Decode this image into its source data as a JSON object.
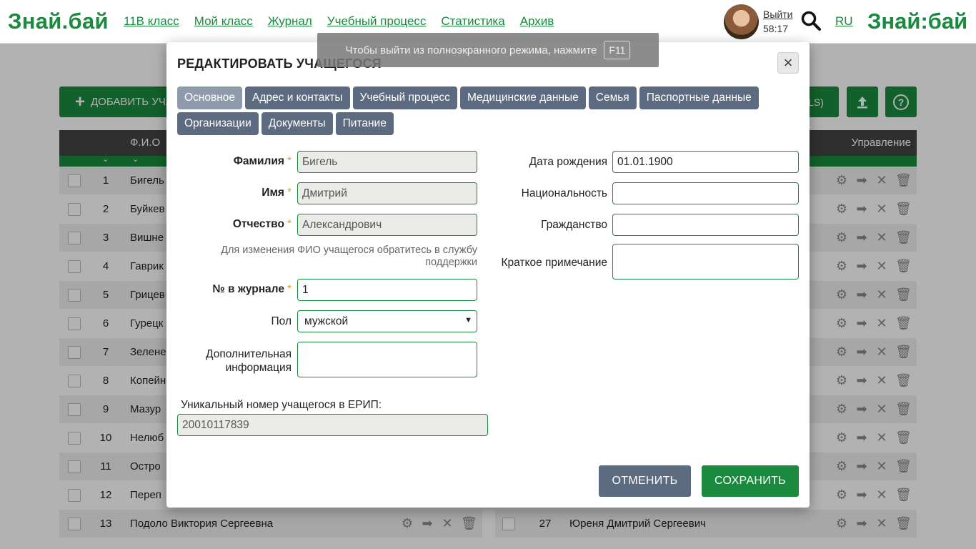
{
  "header": {
    "logo": "Знай.бай",
    "logo_right": "Знай:бай",
    "nav": [
      "11В класс",
      "Мой класс",
      "Журнал",
      "Учебный процесс",
      "Статистика",
      "Архив"
    ],
    "logout": "Выйти",
    "timer": "58:17",
    "lang": "RU"
  },
  "page": {
    "add_button": "ДОБАВИТЬ УЧА",
    "xls_button": "LS)",
    "col_fio": "Ф.И.О",
    "col_controls": "Управление",
    "rows_left": [
      {
        "num": "1",
        "name": "Бигель"
      },
      {
        "num": "2",
        "name": "Буйкев"
      },
      {
        "num": "3",
        "name": "Вишне"
      },
      {
        "num": "4",
        "name": "Гаврик"
      },
      {
        "num": "5",
        "name": "Грицев"
      },
      {
        "num": "6",
        "name": "Гурецк"
      },
      {
        "num": "7",
        "name": "Зелене"
      },
      {
        "num": "8",
        "name": "Копейн"
      },
      {
        "num": "9",
        "name": "Мазур"
      },
      {
        "num": "10",
        "name": "Нелюб"
      },
      {
        "num": "11",
        "name": "Остро"
      },
      {
        "num": "12",
        "name": "Переп"
      },
      {
        "num": "13",
        "name": "Подоло Виктория Сергеевна"
      }
    ],
    "row_right_13": {
      "num": "27",
      "name": "Юреня Дмитрий Сергеевич"
    }
  },
  "toast": {
    "text": "Чтобы выйти из полноэкранного режима, нажмите",
    "key": "F11"
  },
  "modal": {
    "title": "РЕДАКТИРОВАТЬ УЧАЩЕГОСЯ",
    "tabs": [
      "Основное",
      "Адрес и контакты",
      "Учебный процесс",
      "Медицинские данные",
      "Семья",
      "Паспортные данные",
      "Организации",
      "Документы",
      "Питание"
    ],
    "active_tab": "Основное",
    "fields": {
      "surname_label": "Фамилия",
      "surname_value": "Бигель",
      "name_label": "Имя",
      "name_value": "Дмитрий",
      "patronymic_label": "Отчество",
      "patronymic_value": "Александрович",
      "fio_hint": "Для изменения ФИО учащегося обратитесь в службу поддержки",
      "journal_label": "№ в журнале",
      "journal_value": "1",
      "gender_label": "Пол",
      "gender_value": "мужской",
      "extra_label_1": "Дополнительная",
      "extra_label_2": "информация",
      "erip_label": "Уникальный номер учащегося в ЕРИП:",
      "erip_value": "20010117839",
      "birth_label": "Дата рождения",
      "birth_value": "01.01.1900",
      "nationality_label": "Национальность",
      "citizenship_label": "Гражданство",
      "note_label": "Краткое примечание"
    },
    "cancel": "ОТМЕНИТЬ",
    "save": "СОХРАНИТЬ",
    "required_mark": "*"
  },
  "colors": {
    "brand_green": "#1a8a3e",
    "tab_slate": "#5d6b80",
    "tab_active": "#8f9bac",
    "required": "#e0a020"
  }
}
